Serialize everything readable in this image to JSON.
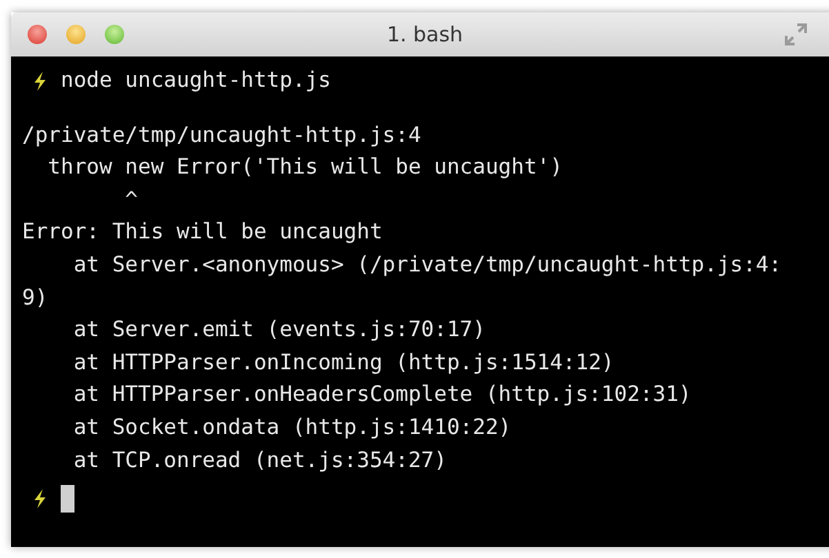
{
  "window": {
    "title": "1. bash"
  },
  "terminal": {
    "command": "node uncaught-http.js",
    "output": [
      "/private/tmp/uncaught-http.js:4",
      "  throw new Error('This will be uncaught')",
      "        ^",
      "Error: This will be uncaught",
      "    at Server.<anonymous> (/private/tmp/uncaught-http.js:4:",
      "9)",
      "    at Server.emit (events.js:70:17)",
      "    at HTTPParser.onIncoming (http.js:1514:12)",
      "    at HTTPParser.onHeadersComplete (http.js:102:31)",
      "    at Socket.ondata (http.js:1410:22)",
      "    at TCP.onread (net.js:354:27)"
    ]
  }
}
